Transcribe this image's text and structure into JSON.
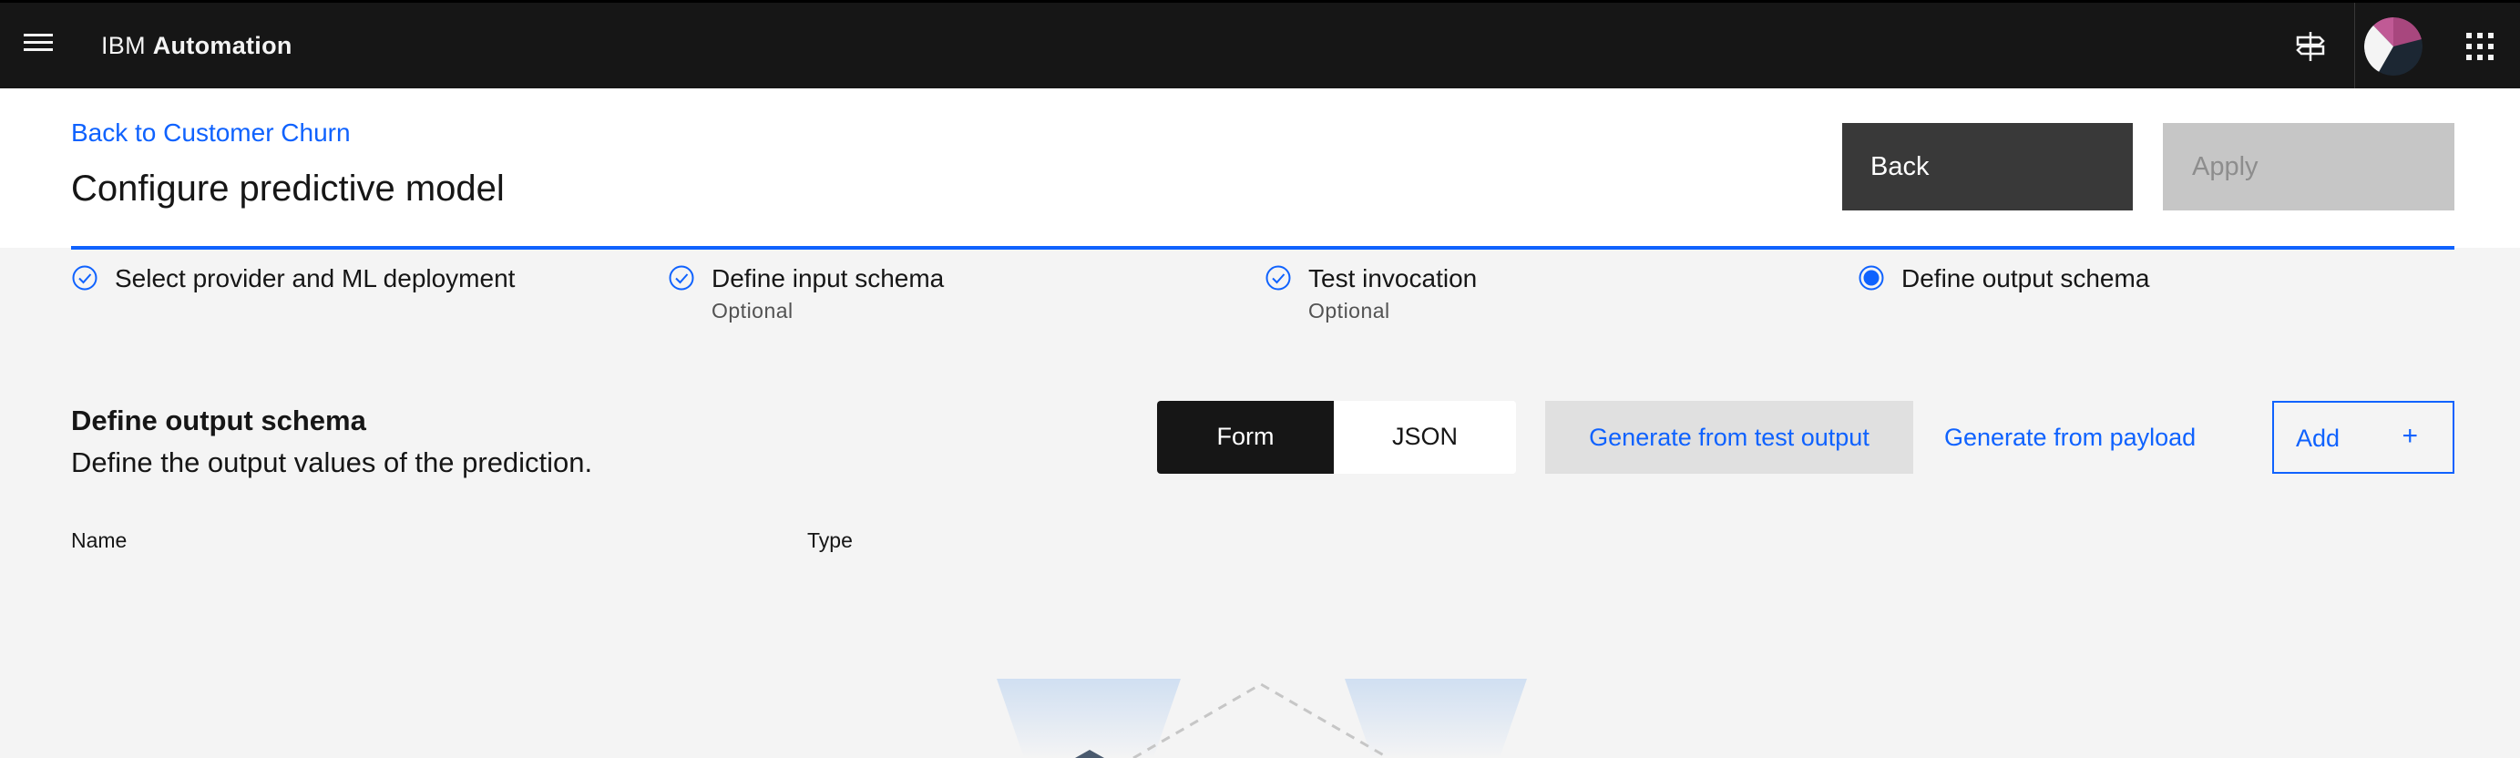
{
  "topbar": {
    "brand_prefix": "IBM",
    "brand_name": "Automation",
    "icons": [
      "menu-icon",
      "signpost-icon",
      "avatar",
      "app-switcher-icon"
    ]
  },
  "header": {
    "back_link": "Back to Customer Churn",
    "title": "Configure predictive model",
    "back_button": "Back",
    "apply_button": "Apply"
  },
  "steps": [
    {
      "label": "Select provider and ML deployment",
      "optional": "",
      "state": "complete"
    },
    {
      "label": "Define input schema",
      "optional": "Optional",
      "state": "complete"
    },
    {
      "label": "Test invocation",
      "optional": "Optional",
      "state": "complete"
    },
    {
      "label": "Define output schema",
      "optional": "",
      "state": "current"
    }
  ],
  "section": {
    "title": "Define output schema",
    "description": "Define the output values of the prediction.",
    "switcher": {
      "form": "Form",
      "json": "JSON",
      "selected": "Form"
    },
    "generate_test_button": "Generate from test output",
    "generate_payload_button": "Generate from payload",
    "add_button": "Add",
    "add_icon": "+"
  },
  "table": {
    "columns": [
      "Name",
      "Type"
    ]
  },
  "colors": {
    "accent": "#0f62fe",
    "topbar": "#161616",
    "page_bg": "#f4f4f4"
  }
}
